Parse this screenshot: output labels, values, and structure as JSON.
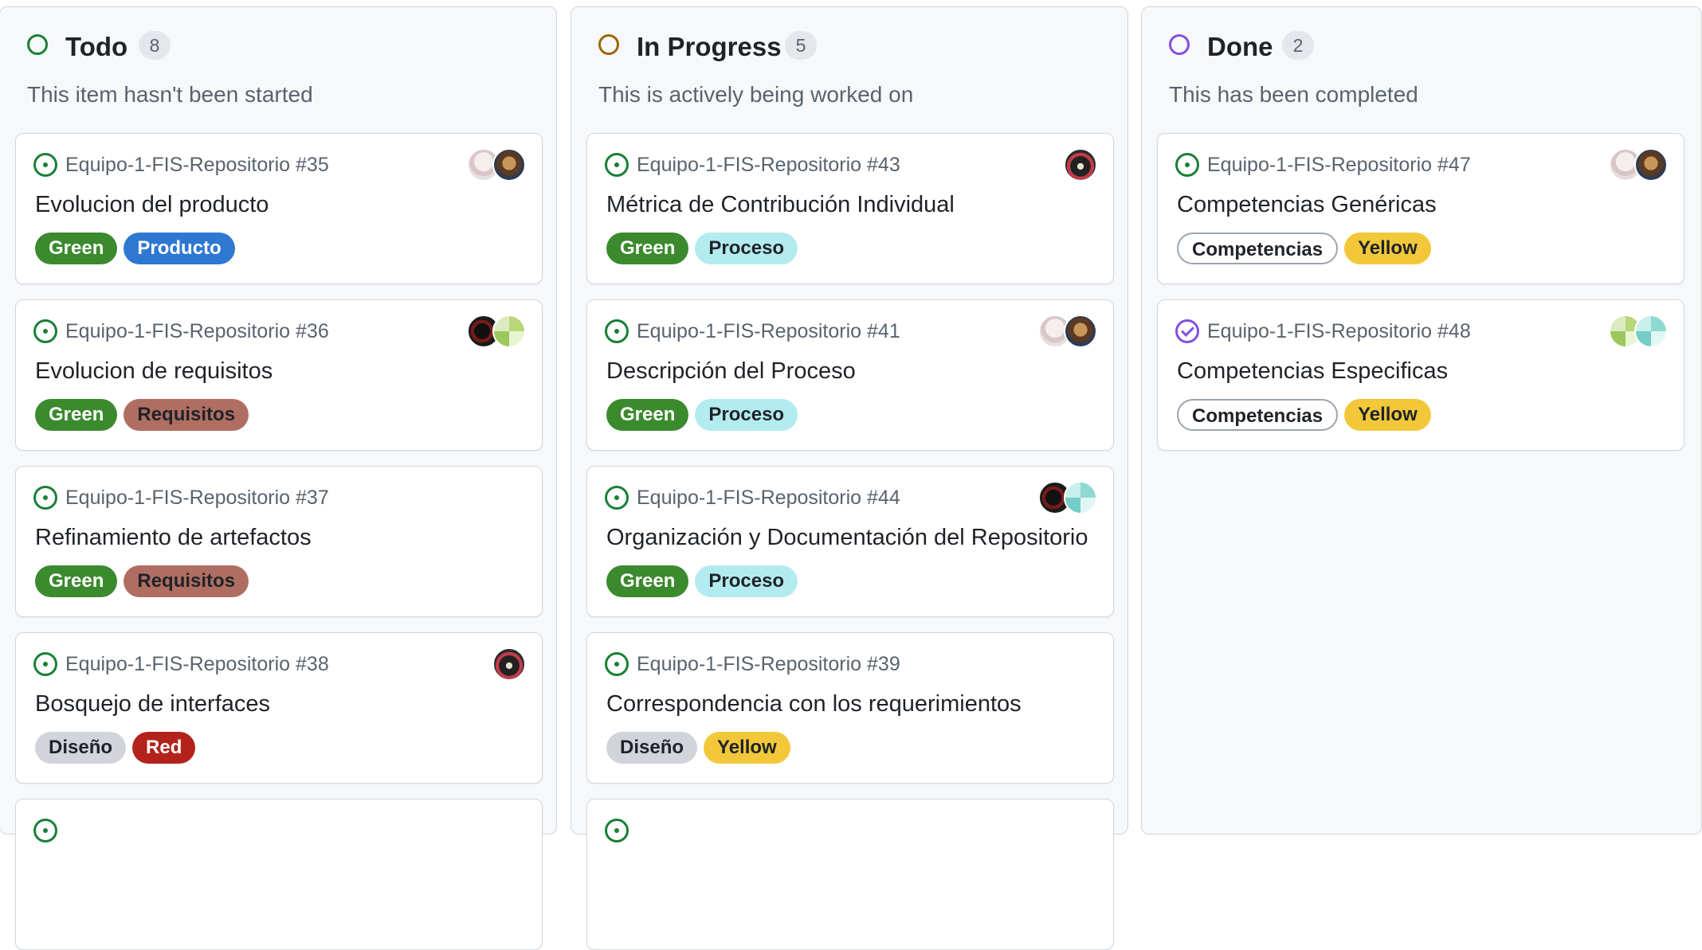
{
  "columns": [
    {
      "title": "Todo",
      "count": "8",
      "description": "This item hasn't been started",
      "status_color": "#1a7f37",
      "cards": [
        {
          "repo": "Equipo-1-FIS-Repositorio #35",
          "title": "Evolucion del producto",
          "state": "open",
          "avatars": [
            "sketch-avatar",
            "portrait-avatar"
          ],
          "labels": [
            {
              "text": "Green",
              "bg": "#3b8a2e",
              "fg": "#ffffff"
            },
            {
              "text": "Producto",
              "bg": "#2e78d2",
              "fg": "#ffffff"
            }
          ]
        },
        {
          "repo": "Equipo-1-FIS-Repositorio #36",
          "title": "Evolucion de requisitos",
          "state": "open",
          "avatars": [
            "dark-avatar",
            "green-pixel-avatar"
          ],
          "labels": [
            {
              "text": "Green",
              "bg": "#3b8a2e",
              "fg": "#ffffff"
            },
            {
              "text": "Requisitos",
              "bg": "#b06e62",
              "fg": "#1f2328"
            }
          ]
        },
        {
          "repo": "Equipo-1-FIS-Repositorio #37",
          "title": "Refinamiento de artefactos",
          "state": "open",
          "avatars": [],
          "labels": [
            {
              "text": "Green",
              "bg": "#3b8a2e",
              "fg": "#ffffff"
            },
            {
              "text": "Requisitos",
              "bg": "#b06e62",
              "fg": "#1f2328"
            }
          ]
        },
        {
          "repo": "Equipo-1-FIS-Repositorio #38",
          "title": "Bosquejo de interfaces",
          "state": "open",
          "avatars": [
            "eye-avatar"
          ],
          "labels": [
            {
              "text": "Diseño",
              "bg": "#d1d5da",
              "fg": "#1f2328"
            },
            {
              "text": "Red",
              "bg": "#b4231b",
              "fg": "#ffffff"
            }
          ]
        }
      ]
    },
    {
      "title": "In Progress",
      "count": "5",
      "description": "This is actively being worked on",
      "status_color": "#9a6700",
      "cards": [
        {
          "repo": "Equipo-1-FIS-Repositorio #43",
          "title": "Métrica de Contribución Individual",
          "state": "open",
          "avatars": [
            "eye-avatar"
          ],
          "labels": [
            {
              "text": "Green",
              "bg": "#3b8a2e",
              "fg": "#ffffff"
            },
            {
              "text": "Proceso",
              "bg": "#b3ecf0",
              "fg": "#1f2328"
            }
          ]
        },
        {
          "repo": "Equipo-1-FIS-Repositorio #41",
          "title": "Descripción del Proceso",
          "state": "open",
          "avatars": [
            "sketch-avatar",
            "portrait-avatar"
          ],
          "labels": [
            {
              "text": "Green",
              "bg": "#3b8a2e",
              "fg": "#ffffff"
            },
            {
              "text": "Proceso",
              "bg": "#b3ecf0",
              "fg": "#1f2328"
            }
          ]
        },
        {
          "repo": "Equipo-1-FIS-Repositorio #44",
          "title": "Organización y Documentación del Repositorio",
          "state": "open",
          "avatars": [
            "dark-avatar",
            "teal-pixel-avatar"
          ],
          "labels": [
            {
              "text": "Green",
              "bg": "#3b8a2e",
              "fg": "#ffffff"
            },
            {
              "text": "Proceso",
              "bg": "#b3ecf0",
              "fg": "#1f2328"
            }
          ]
        },
        {
          "repo": "Equipo-1-FIS-Repositorio #39",
          "title": "Correspondencia con los requerimientos",
          "state": "open",
          "avatars": [],
          "labels": [
            {
              "text": "Diseño",
              "bg": "#d1d5da",
              "fg": "#1f2328"
            },
            {
              "text": "Yellow",
              "bg": "#f2c83a",
              "fg": "#1f2328"
            }
          ]
        }
      ]
    },
    {
      "title": "Done",
      "count": "2",
      "description": "This has been completed",
      "status_color": "#8250df",
      "cards": [
        {
          "repo": "Equipo-1-FIS-Repositorio #47",
          "title": "Competencias Genéricas",
          "state": "open",
          "avatars": [
            "sketch-avatar",
            "portrait-avatar"
          ],
          "labels": [
            {
              "text": "Competencias",
              "bg": "#ffffff",
              "fg": "#1f2328",
              "border": "#9da5ad"
            },
            {
              "text": "Yellow",
              "bg": "#f2c83a",
              "fg": "#1f2328"
            }
          ]
        },
        {
          "repo": "Equipo-1-FIS-Repositorio #48",
          "title": "Competencias Especificas",
          "state": "closed",
          "avatars": [
            "green-pixel-avatar",
            "teal-pixel-avatar"
          ],
          "labels": [
            {
              "text": "Competencias",
              "bg": "#ffffff",
              "fg": "#1f2328",
              "border": "#9da5ad"
            },
            {
              "text": "Yellow",
              "bg": "#f2c83a",
              "fg": "#1f2328"
            }
          ]
        }
      ]
    }
  ]
}
